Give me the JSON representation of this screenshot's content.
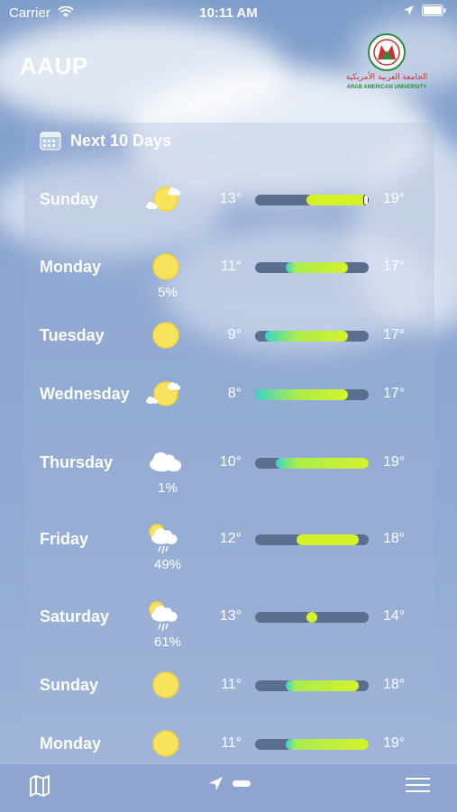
{
  "status_bar": {
    "carrier": "Carrier",
    "time": "10:11 AM"
  },
  "app_title": "AAUP",
  "logo": {
    "arabic_text": "الجامعة العربية الأمريكية",
    "english_text": "ARAB AMERICAN UNIVERSITY"
  },
  "forecast": {
    "heading": "Next 10 Days",
    "scale_min": 8,
    "scale_max": 19,
    "days": [
      {
        "day": "Sunday",
        "icon": "partly-cloudy-sun-icon",
        "precip": "",
        "low": "13°",
        "high": "19°",
        "low_value": 13,
        "high_value": 19,
        "current_marker": true
      },
      {
        "day": "Monday",
        "icon": "sun-icon",
        "precip": "5%",
        "low": "11°",
        "high": "17°",
        "low_value": 11,
        "high_value": 17
      },
      {
        "day": "Tuesday",
        "icon": "sun-icon",
        "precip": "",
        "low": "9°",
        "high": "17°",
        "low_value": 9,
        "high_value": 17
      },
      {
        "day": "Wednesday",
        "icon": "partly-cloudy-sun-icon",
        "precip": "",
        "low": "8°",
        "high": "17°",
        "low_value": 8,
        "high_value": 17
      },
      {
        "day": "Thursday",
        "icon": "cloud-icon",
        "precip": "1%",
        "low": "10°",
        "high": "19°",
        "low_value": 10,
        "high_value": 19
      },
      {
        "day": "Friday",
        "icon": "sun-cloud-rain-icon",
        "precip": "49%",
        "low": "12°",
        "high": "18°",
        "low_value": 12,
        "high_value": 18
      },
      {
        "day": "Saturday",
        "icon": "sun-cloud-rain-icon",
        "precip": "61%",
        "low": "13°",
        "high": "14°",
        "low_value": 13,
        "high_value": 14
      },
      {
        "day": "Sunday",
        "icon": "sun-icon",
        "precip": "",
        "low": "11°",
        "high": "18°",
        "low_value": 11,
        "high_value": 18
      },
      {
        "day": "Monday",
        "icon": "sun-icon",
        "precip": "",
        "low": "11°",
        "high": "19°",
        "low_value": 11,
        "high_value": 19
      }
    ]
  },
  "tab_bar": {
    "items": [
      "map-icon",
      "location-arrow-icon",
      "menu-icon"
    ]
  },
  "colors": {
    "bar_track": "#5a6f8f",
    "warm": "#d5f229",
    "cool": "#3ad3c8",
    "sun": "#f9e25c"
  }
}
